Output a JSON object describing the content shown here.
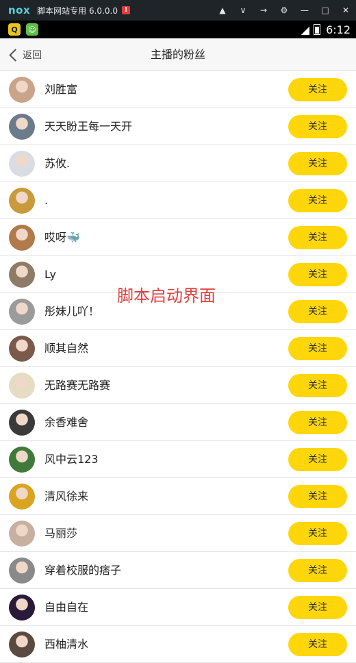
{
  "emulator": {
    "logo": "nox",
    "title": "脚本网站专用 6.0.0.0",
    "alert": "!"
  },
  "status_bar": {
    "time": "6:12"
  },
  "header": {
    "back_label": "返回",
    "title": "主播的粉丝"
  },
  "follow_label": "关注",
  "fans": [
    {
      "name": "刘胜富",
      "avatar_color": "#c9a48a"
    },
    {
      "name": "天天盼王每一天开",
      "avatar_color": "#6b7b8c"
    },
    {
      "name": "苏攸.",
      "avatar_color": "#d9dde3"
    },
    {
      "name": ".",
      "avatar_color": "#c89a3b"
    },
    {
      "name": "哎呀🐳",
      "avatar_color": "#b07a4a"
    },
    {
      "name": "Ly",
      "avatar_color": "#8f7a68"
    },
    {
      "name": "彤妹儿吖！",
      "avatar_color": "#9b9b9b"
    },
    {
      "name": "顺其自然",
      "avatar_color": "#7a5a4a"
    },
    {
      "name": "无路赛无路赛",
      "avatar_color": "#e6dcc4"
    },
    {
      "name": "余香难舍",
      "avatar_color": "#3a3a3a"
    },
    {
      "name": "风中云123",
      "avatar_color": "#3f7a3a"
    },
    {
      "name": "清风徐来",
      "avatar_color": "#d9a520"
    },
    {
      "name": "马丽莎",
      "avatar_color": "#c8b0a0"
    },
    {
      "name": "穿着校服的痞子",
      "avatar_color": "#8a8a8a"
    },
    {
      "name": "自由自在",
      "avatar_color": "#2a1a3a"
    },
    {
      "name": "西柚清水",
      "avatar_color": "#5a4a40"
    }
  ],
  "overlay_text": "脚本启动界面"
}
